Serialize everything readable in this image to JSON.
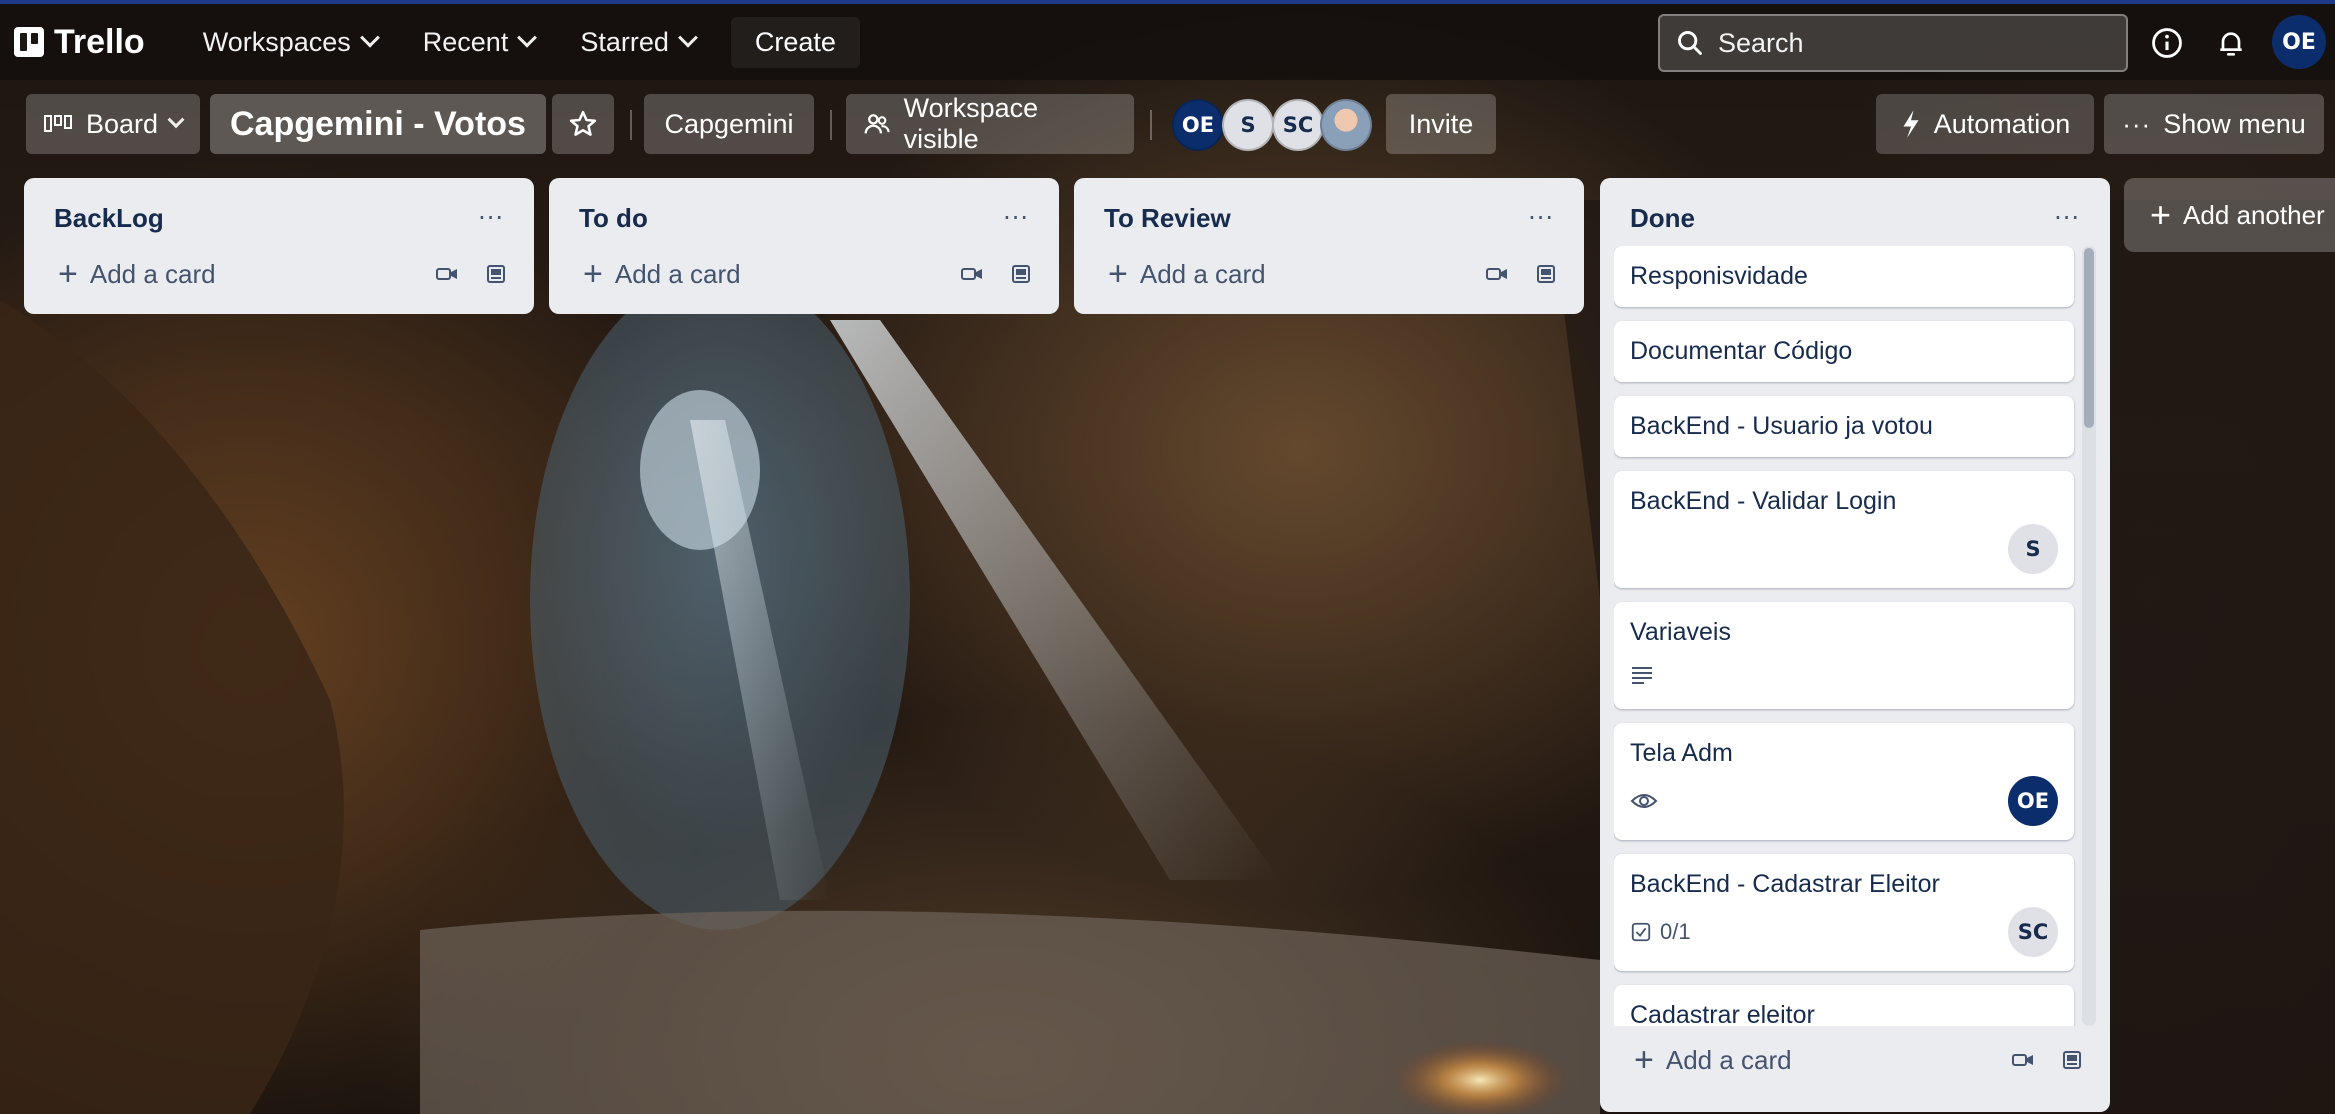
{
  "nav": {
    "logo": "Trello",
    "workspaces": "Workspaces",
    "recent": "Recent",
    "starred": "Starred",
    "create": "Create",
    "search_placeholder": "Search",
    "user_initials": "OE"
  },
  "board": {
    "view": "Board",
    "title": "Capgemini - Votos",
    "workspace": "Capgemini",
    "visibility": "Workspace visible",
    "members": [
      "OE",
      "S",
      "SC"
    ],
    "invite": "Invite",
    "automation": "Automation",
    "show_menu": "Show menu"
  },
  "lists": [
    {
      "title": "BackLog",
      "add": "Add a card"
    },
    {
      "title": "To do",
      "add": "Add a card"
    },
    {
      "title": "To Review",
      "add": "Add a card"
    },
    {
      "title": "Done",
      "add": "Add a card",
      "cards": [
        {
          "title": "Responisvidade"
        },
        {
          "title": "Documentar Código"
        },
        {
          "title": "BackEnd - Usuario ja votou"
        },
        {
          "title": "BackEnd - Validar Login",
          "member": "S"
        },
        {
          "title": "Variaveis",
          "badge": "description"
        },
        {
          "title": "Tela Adm",
          "badge": "watching",
          "member": "OE"
        },
        {
          "title": "BackEnd - Cadastrar Eleitor",
          "checklist": "0/1",
          "member": "SC"
        },
        {
          "title": "Cadastrar eleitor"
        }
      ]
    }
  ],
  "add_another": "Add another",
  "colors": {
    "accent_dark": "#0c2d6b",
    "list_bg": "#ebecf0",
    "text": "#172b4d"
  }
}
